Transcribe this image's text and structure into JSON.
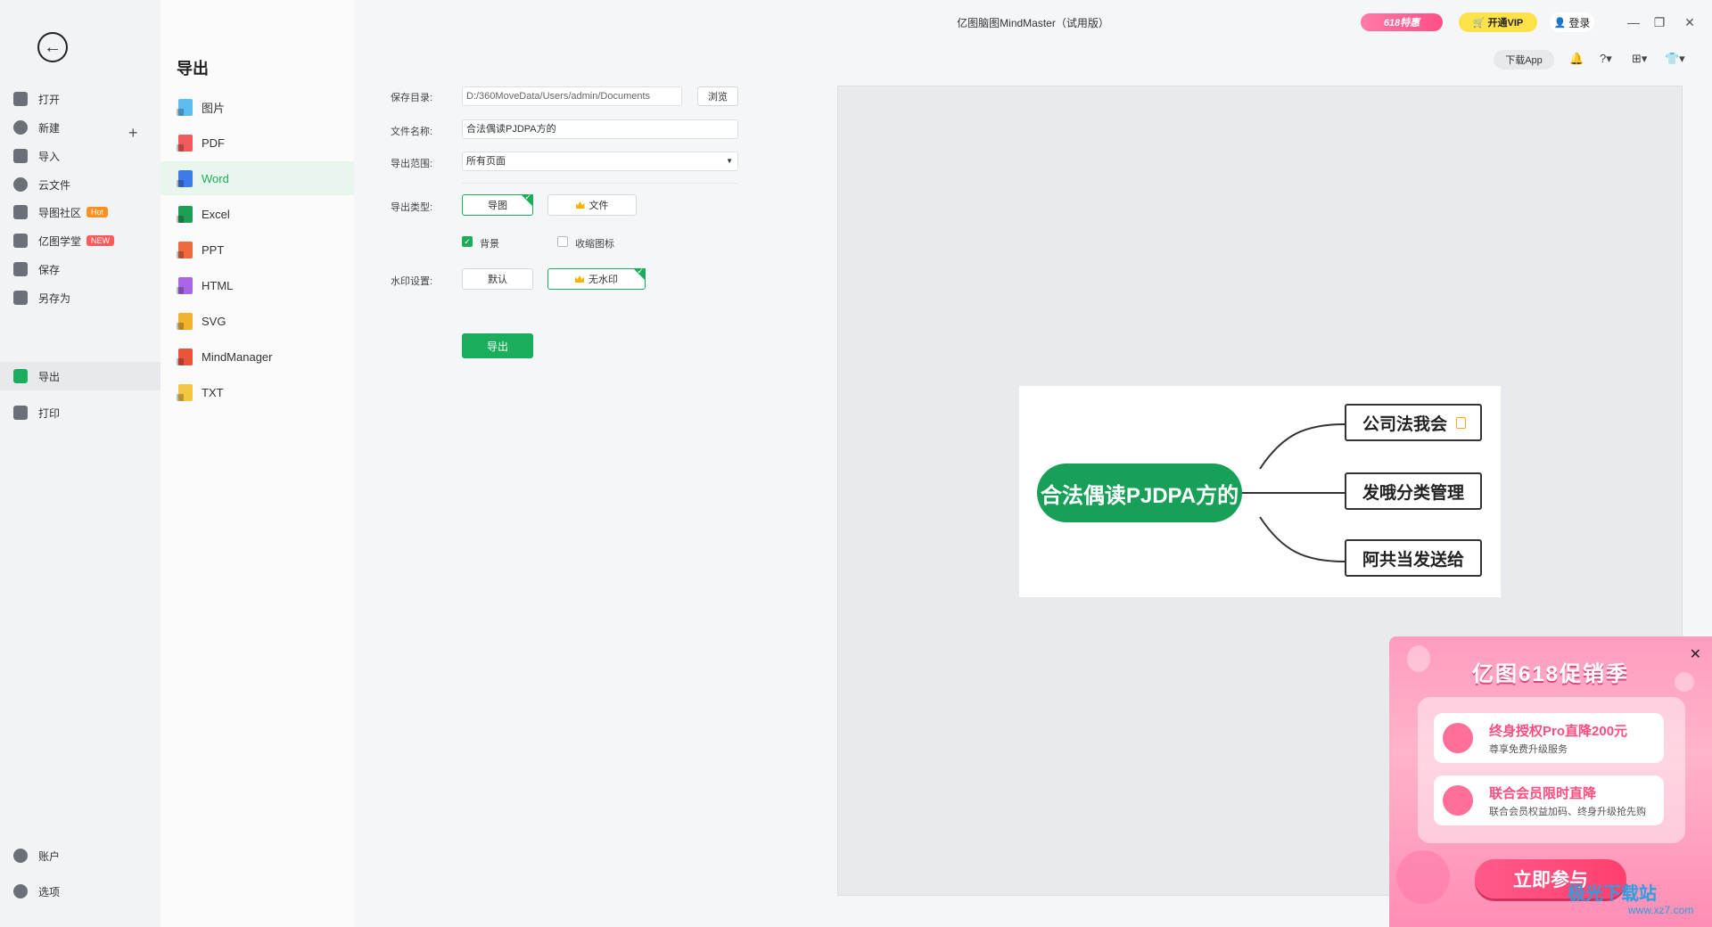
{
  "window": {
    "title": "亿图脑图MindMaster（试用版）"
  },
  "header": {
    "promo_badge": "618特惠",
    "vip_label": "开通VIP",
    "login_label": "登录",
    "download_app": "下载App"
  },
  "nav": {
    "items": [
      {
        "label": "打开"
      },
      {
        "label": "新建"
      },
      {
        "label": "导入"
      },
      {
        "label": "云文件"
      },
      {
        "label": "导图社区",
        "badge": "Hot"
      },
      {
        "label": "亿图学堂",
        "badge": "NEW"
      },
      {
        "label": "保存"
      },
      {
        "label": "另存为"
      },
      {
        "label": "导出"
      },
      {
        "label": "打印"
      }
    ],
    "bottom": [
      {
        "label": "账户"
      },
      {
        "label": "选项"
      }
    ]
  },
  "export_panel": {
    "title": "导出",
    "formats": [
      "图片",
      "PDF",
      "Word",
      "Excel",
      "PPT",
      "HTML",
      "SVG",
      "MindManager",
      "TXT"
    ],
    "active_format": "Word"
  },
  "form": {
    "save_dir_label": "保存目录:",
    "save_dir_value": "D:/360MoveData/Users/admin/Documents",
    "browse_label": "浏览",
    "file_name_label": "文件名称:",
    "file_name_value": "合法偶读PJDPA方的",
    "range_label": "导出范围:",
    "range_value": "所有页面",
    "type_label": "导出类型:",
    "type_options": [
      "导图",
      "文件"
    ],
    "background_label": "背景",
    "collapse_icon_label": "收缩图标",
    "watermark_label": "水印设置:",
    "watermark_options": [
      "默认",
      "无水印"
    ],
    "export_button": "导出"
  },
  "mindmap": {
    "central": "合法偶读PJDPA方的",
    "branches": [
      "公司法我会",
      "发哦分类管理",
      "阿共当发送给"
    ]
  },
  "promo": {
    "title": "亿图618促销季",
    "offers": [
      {
        "title": "终身授权Pro直降200元",
        "subtitle": "尊享免费升级服务"
      },
      {
        "title": "联合会员限时直降",
        "subtitle": "联合会员权益加码、终身升级抢先购"
      }
    ],
    "cta": "立即参与",
    "watermark": "极光下载站",
    "watermark_url": "www.xz7.com"
  },
  "colors": {
    "accent": "#1aad5c",
    "mind_central": "#18a058",
    "promo_pink": "#ff4d7f",
    "vip_yellow": "#ffe24a"
  }
}
